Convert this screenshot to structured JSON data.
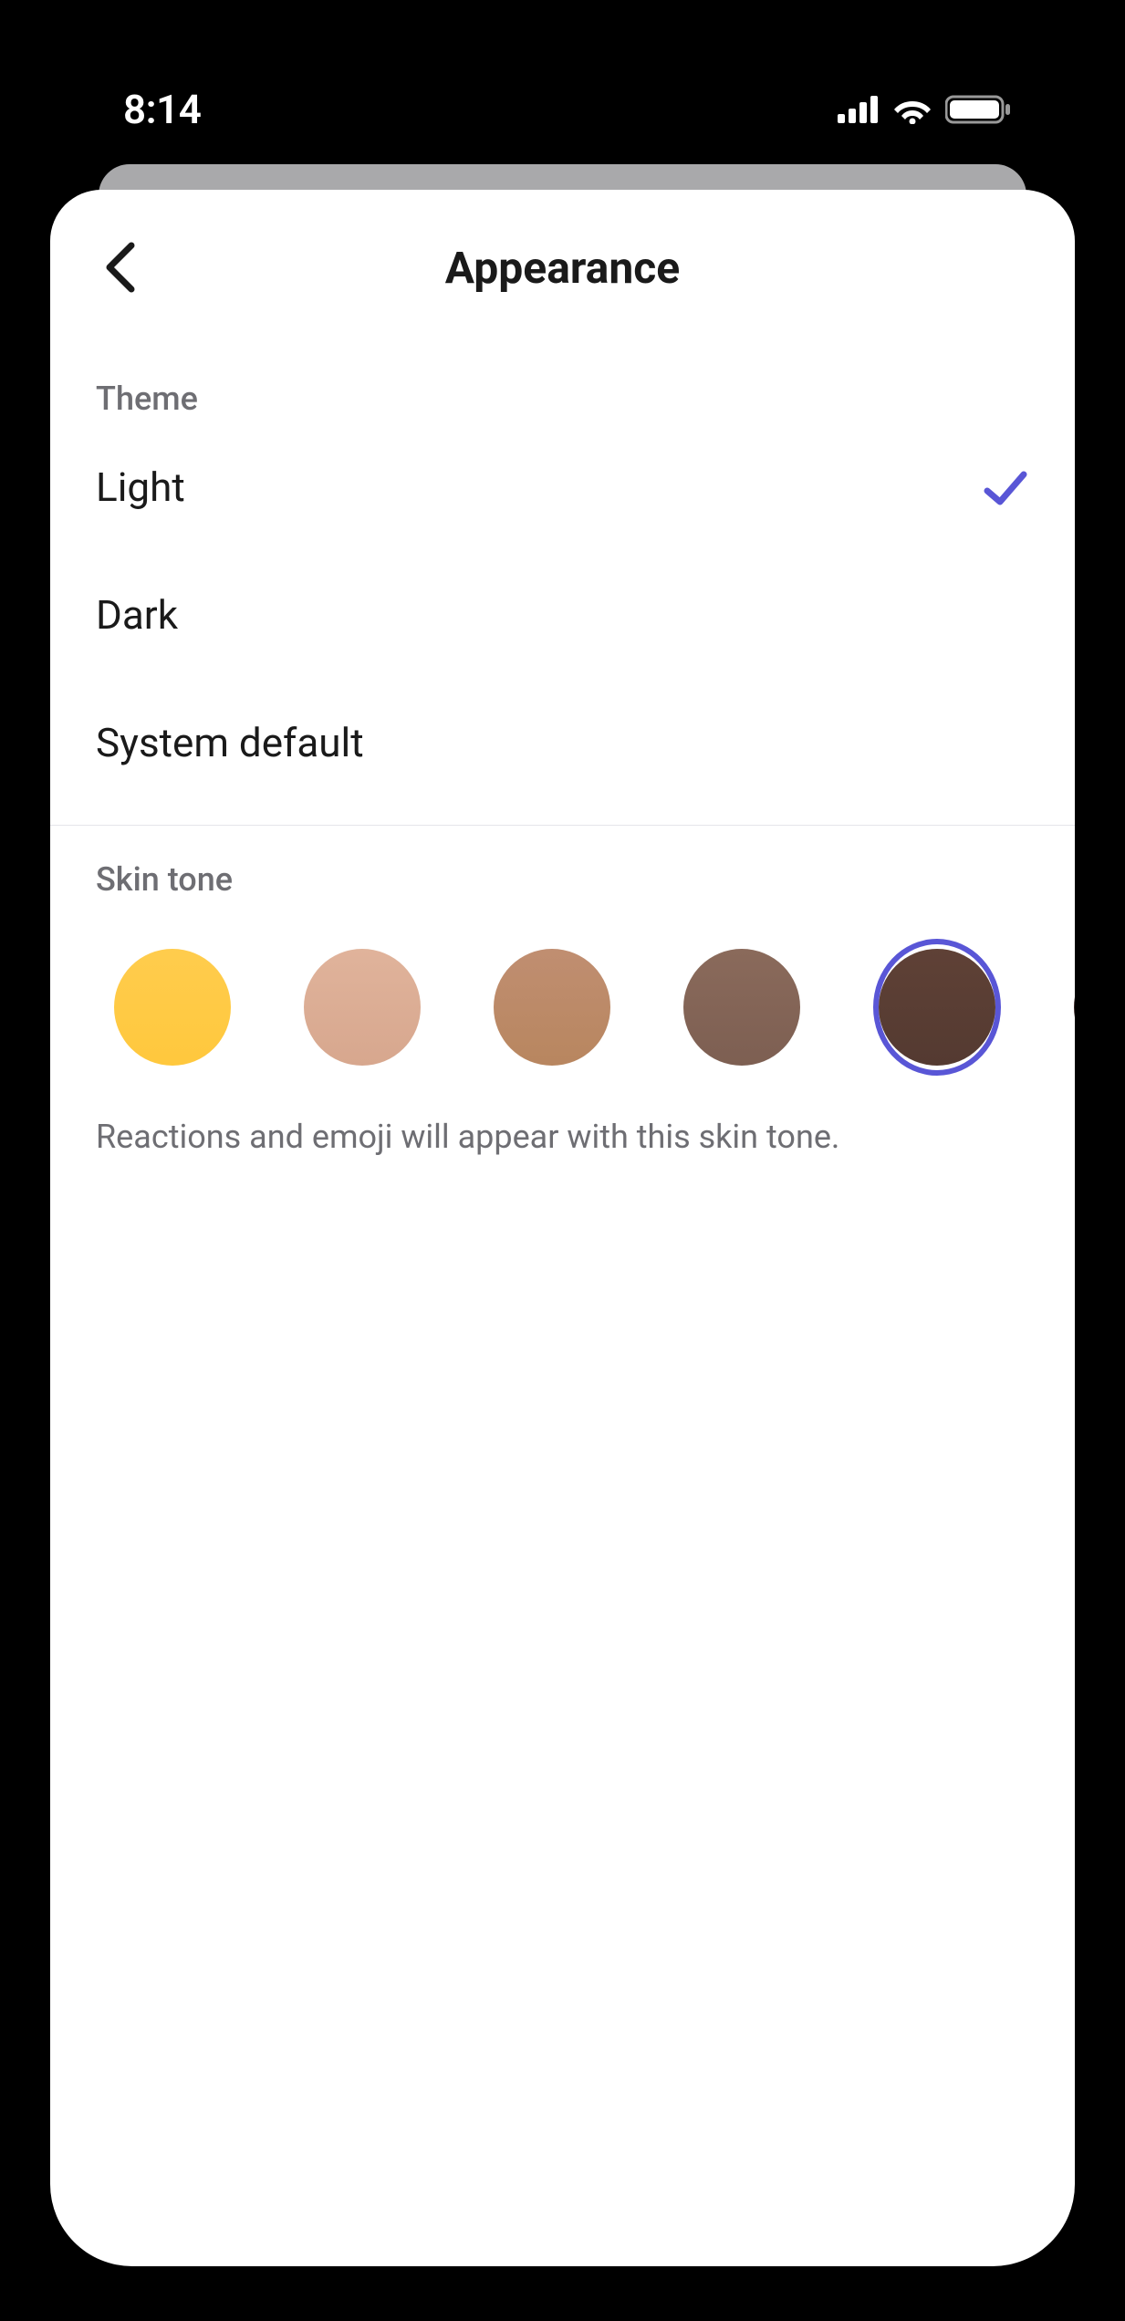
{
  "status": {
    "time": "8:14"
  },
  "header": {
    "title": "Appearance"
  },
  "theme": {
    "section_label": "Theme",
    "options": [
      {
        "label": "Light",
        "selected": true
      },
      {
        "label": "Dark",
        "selected": false
      },
      {
        "label": "System default",
        "selected": false
      }
    ]
  },
  "skin_tone": {
    "section_label": "Skin tone",
    "description": "Reactions and emoji will appear with this skin tone.",
    "swatches": [
      {
        "color_top": "#ffcc4d",
        "color_bottom": "#ffc83d",
        "selected": false
      },
      {
        "color_top": "#e0b39b",
        "color_bottom": "#d7a78e",
        "selected": false
      },
      {
        "color_top": "#c08e71",
        "color_bottom": "#b8865f",
        "selected": false
      },
      {
        "color_top": "#8a6a5b",
        "color_bottom": "#7d5f52",
        "selected": false
      },
      {
        "color_top": "#5f4136",
        "color_bottom": "#543a31",
        "selected": true
      },
      {
        "color_top": "#33211f",
        "color_bottom": "#2a1b1a",
        "selected": false
      }
    ]
  },
  "colors": {
    "accent": "#5956d6"
  }
}
